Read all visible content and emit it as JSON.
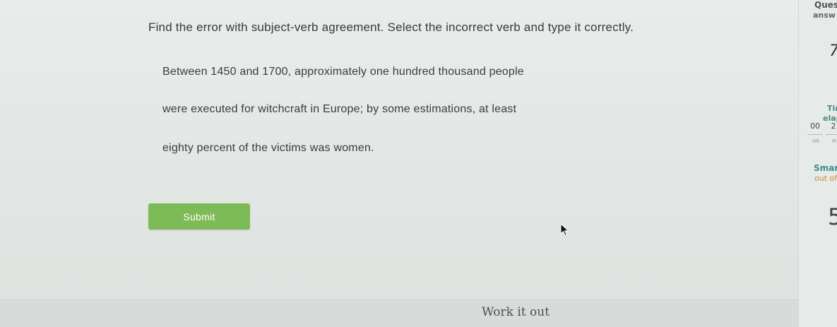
{
  "question": {
    "instructions": "Find the error with subject-verb agreement. Select the incorrect verb and type it correctly.",
    "passage_lines": [
      "Between 1450 and 1700, approximately one hundred thousand people",
      "were executed for witchcraft in Europe; by some estimations, at least",
      "eighty percent of the victims was women."
    ]
  },
  "submit_label": "Submit",
  "footer": {
    "work_it_out": "Work it out"
  },
  "sidebar": {
    "questions_label": "Quest",
    "answered_label": "answ",
    "answered_value": "7",
    "time_label": "Tir",
    "elapsed_label": "elap",
    "hours_value": "00",
    "minutes_value": "2",
    "hours_unit": "HR",
    "minutes_unit": "M",
    "smartscore_label": "Smar",
    "out_of_label": "out of",
    "smartscore_value": "5"
  },
  "colors": {
    "submit": "#7dbb57",
    "accent_teal": "#3d8b8e",
    "accent_orange": "#d08a2a"
  }
}
